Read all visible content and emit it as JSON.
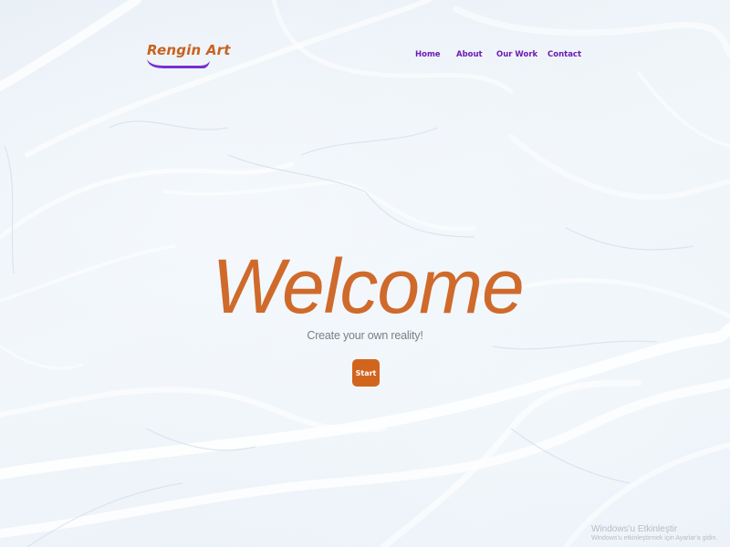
{
  "brand": {
    "name": "Rengin Art",
    "color": "#c8621f",
    "swoosh_color": "#7a2fd0"
  },
  "nav": {
    "items": [
      {
        "label": "Home"
      },
      {
        "label": "About"
      },
      {
        "label": "Our Work"
      },
      {
        "label": "Contact"
      }
    ],
    "color": "#6a1bb5"
  },
  "hero": {
    "title": "Welcome",
    "subtitle": "Create your own reality!",
    "cta_label": "Start",
    "accent": "#d2651e"
  },
  "watermark": {
    "line1": "Windows'u Etkinleştir",
    "line2": "Windows'u etkinleştirmek için Ayarlar'a gidin."
  }
}
